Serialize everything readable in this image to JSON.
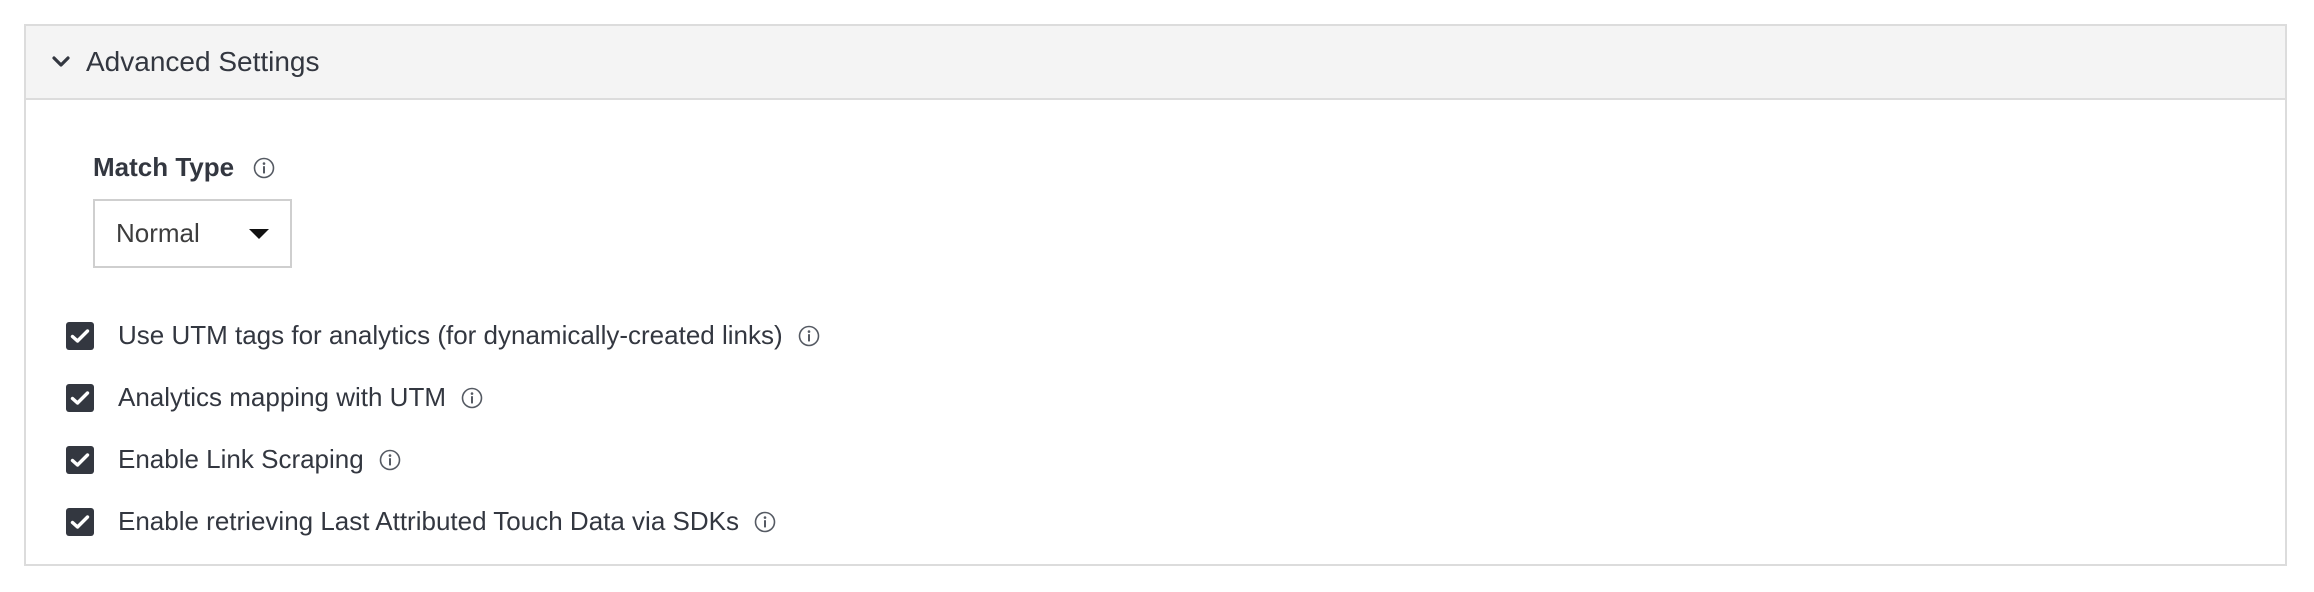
{
  "section": {
    "title": "Advanced Settings",
    "collapse_icon": "chevron-down-icon"
  },
  "match_type": {
    "label": "Match Type",
    "info_icon": "info-icon",
    "selected": "Normal",
    "dropdown_icon": "caret-down-icon"
  },
  "checkboxes": [
    {
      "label": "Use UTM tags for analytics (for dynamically-created links)",
      "checked": true
    },
    {
      "label": "Analytics mapping with UTM",
      "checked": true
    },
    {
      "label": "Enable Link Scraping",
      "checked": true
    },
    {
      "label": "Enable retrieving Last Attributed Touch Data via SDKs",
      "checked": true
    }
  ],
  "colors": {
    "text": "#333740",
    "header_bg": "#f4f4f4",
    "border": "#dcdcdc",
    "checkbox_fill": "#333740"
  }
}
